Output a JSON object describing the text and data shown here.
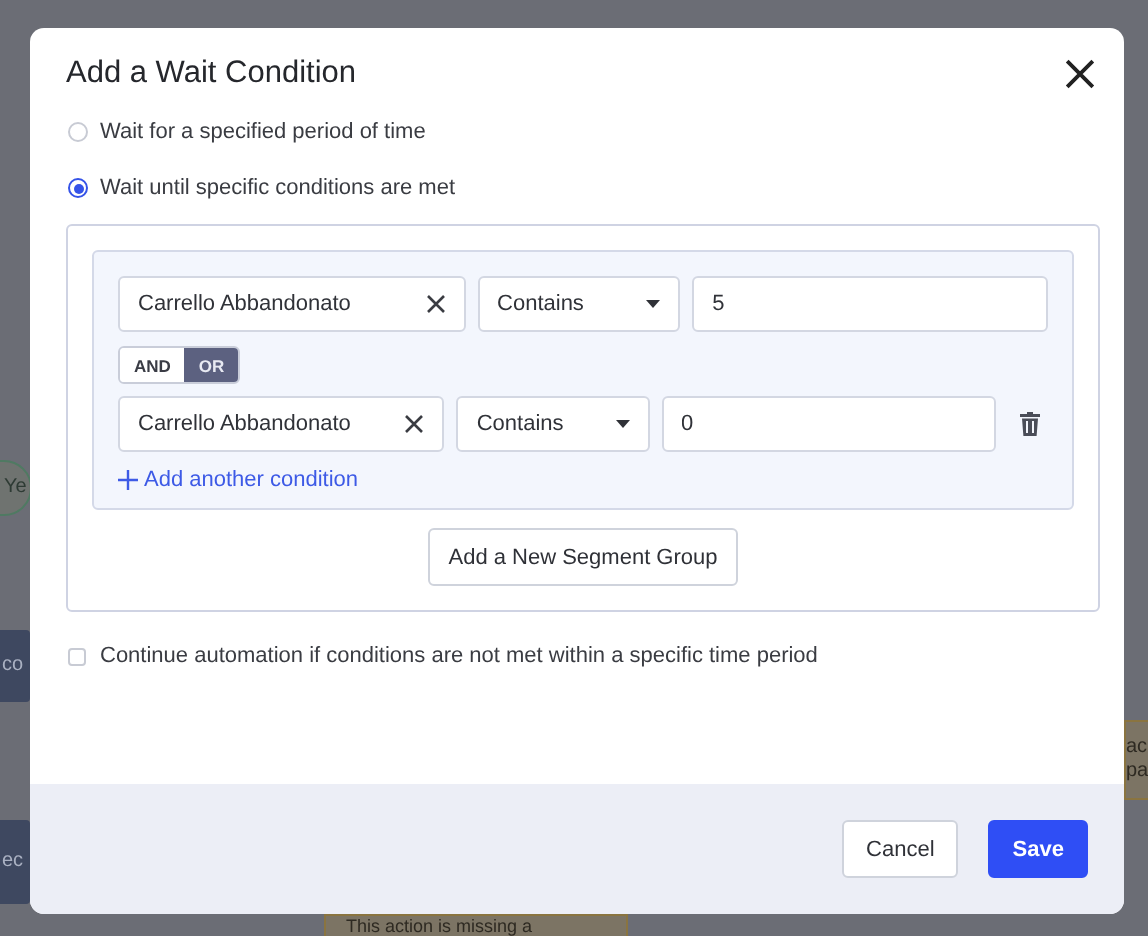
{
  "background": {
    "nodes": [
      {
        "kind": "pill",
        "lines": [
          "Ye"
        ]
      },
      {
        "kind": "block",
        "lines": [
          "co"
        ]
      },
      {
        "kind": "block",
        "lines": [
          "ec"
        ]
      },
      {
        "kind": "note",
        "lines": [
          "ac",
          "pa"
        ]
      },
      {
        "kind": "note",
        "lines": [
          "This action is missing a"
        ]
      }
    ]
  },
  "modal": {
    "title": "Add a Wait Condition",
    "options": [
      {
        "label": "Wait for a specified period of time",
        "selected": false
      },
      {
        "label": "Wait until specific conditions are met",
        "selected": true
      }
    ],
    "group": {
      "conditions": [
        {
          "field": "Carrello Abbandonato",
          "operator": "Contains",
          "value": "5",
          "removable": false
        },
        {
          "field": "Carrello Abbandonato",
          "operator": "Contains",
          "value": "0",
          "removable": true
        }
      ],
      "logic": [
        {
          "label": "AND",
          "selected": false
        },
        {
          "label": "OR",
          "selected": true
        }
      ],
      "add_condition": "Add another condition"
    },
    "add_group": "Add a New Segment Group",
    "continue_option": {
      "label": "Continue automation if conditions are not met within a specific time period",
      "checked": false
    },
    "buttons": [
      {
        "label": "Cancel",
        "kind": "secondary"
      },
      {
        "label": "Save",
        "kind": "primary"
      }
    ]
  }
}
